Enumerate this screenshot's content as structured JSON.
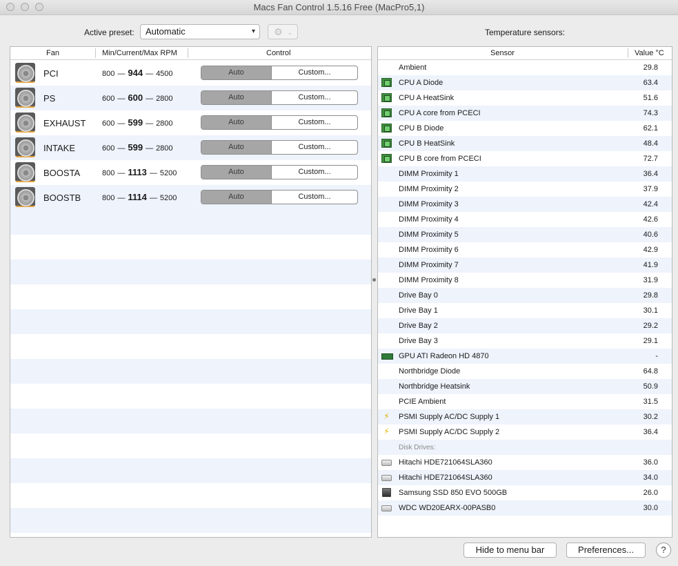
{
  "window": {
    "title": "Macs Fan Control 1.5.16 Free (MacPro5,1)"
  },
  "preset": {
    "label": "Active preset:",
    "value": "Automatic",
    "gear_icon": "gear-icon"
  },
  "temperature_label": "Temperature sensors:",
  "fans_table": {
    "headers": {
      "fan": "Fan",
      "rpm": "Min/Current/Max RPM",
      "control": "Control"
    },
    "rows": [
      {
        "name": "PCI",
        "min": "800",
        "current": "944",
        "max": "4500",
        "auto_label": "Auto",
        "custom_label": "Custom..."
      },
      {
        "name": "PS",
        "min": "600",
        "current": "600",
        "max": "2800",
        "auto_label": "Auto",
        "custom_label": "Custom..."
      },
      {
        "name": "EXHAUST",
        "min": "600",
        "current": "599",
        "max": "2800",
        "auto_label": "Auto",
        "custom_label": "Custom..."
      },
      {
        "name": "INTAKE",
        "min": "600",
        "current": "599",
        "max": "2800",
        "auto_label": "Auto",
        "custom_label": "Custom..."
      },
      {
        "name": "BOOSTA",
        "min": "800",
        "current": "1113",
        "max": "5200",
        "auto_label": "Auto",
        "custom_label": "Custom..."
      },
      {
        "name": "BOOSTB",
        "min": "800",
        "current": "1114",
        "max": "5200",
        "auto_label": "Auto",
        "custom_label": "Custom..."
      }
    ],
    "dash": "—"
  },
  "sensors_table": {
    "headers": {
      "sensor": "Sensor",
      "value": "Value °C"
    },
    "rows": [
      {
        "name": "Ambient",
        "value": "29.8",
        "icon": "none"
      },
      {
        "name": "CPU A Diode",
        "value": "63.4",
        "icon": "cpu"
      },
      {
        "name": "CPU A HeatSink",
        "value": "51.6",
        "icon": "cpu"
      },
      {
        "name": "CPU A core from PCECI",
        "value": "74.3",
        "icon": "cpu"
      },
      {
        "name": "CPU B Diode",
        "value": "62.1",
        "icon": "cpu"
      },
      {
        "name": "CPU B HeatSink",
        "value": "48.4",
        "icon": "cpu"
      },
      {
        "name": "CPU B core from PCECI",
        "value": "72.7",
        "icon": "cpu"
      },
      {
        "name": "DIMM Proximity 1",
        "value": "36.4",
        "icon": "none"
      },
      {
        "name": "DIMM Proximity 2",
        "value": "37.9",
        "icon": "none"
      },
      {
        "name": "DIMM Proximity 3",
        "value": "42.4",
        "icon": "none"
      },
      {
        "name": "DIMM Proximity 4",
        "value": "42.6",
        "icon": "none"
      },
      {
        "name": "DIMM Proximity 5",
        "value": "40.6",
        "icon": "none"
      },
      {
        "name": "DIMM Proximity 6",
        "value": "42.9",
        "icon": "none"
      },
      {
        "name": "DIMM Proximity 7",
        "value": "41.9",
        "icon": "none"
      },
      {
        "name": "DIMM Proximity 8",
        "value": "31.9",
        "icon": "none"
      },
      {
        "name": "Drive Bay 0",
        "value": "29.8",
        "icon": "none"
      },
      {
        "name": "Drive Bay 1",
        "value": "30.1",
        "icon": "none"
      },
      {
        "name": "Drive Bay 2",
        "value": "29.2",
        "icon": "none"
      },
      {
        "name": "Drive Bay 3",
        "value": "29.1",
        "icon": "none"
      },
      {
        "name": "GPU ATI Radeon HD 4870",
        "value": "-",
        "icon": "gpu"
      },
      {
        "name": "Northbridge Diode",
        "value": "64.8",
        "icon": "none"
      },
      {
        "name": "Northbridge Heatsink",
        "value": "50.9",
        "icon": "none"
      },
      {
        "name": "PCIE Ambient",
        "value": "31.5",
        "icon": "none"
      },
      {
        "name": "PSMI Supply AC/DC Supply 1",
        "value": "30.2",
        "icon": "bolt"
      },
      {
        "name": "PSMI Supply AC/DC Supply 2",
        "value": "36.4",
        "icon": "bolt"
      },
      {
        "name": "Disk Drives:",
        "value": "",
        "icon": "group"
      },
      {
        "name": "Hitachi HDE721064SLA360",
        "value": "36.0",
        "icon": "hdd"
      },
      {
        "name": "Hitachi HDE721064SLA360",
        "value": "34.0",
        "icon": "hdd"
      },
      {
        "name": "Samsung SSD 850 EVO 500GB",
        "value": "26.0",
        "icon": "ssd"
      },
      {
        "name": "WDC WD20EARX-00PASB0",
        "value": "30.0",
        "icon": "hdd"
      }
    ]
  },
  "footer": {
    "hide_label": "Hide to menu bar",
    "prefs_label": "Preferences...",
    "help_label": "?"
  }
}
